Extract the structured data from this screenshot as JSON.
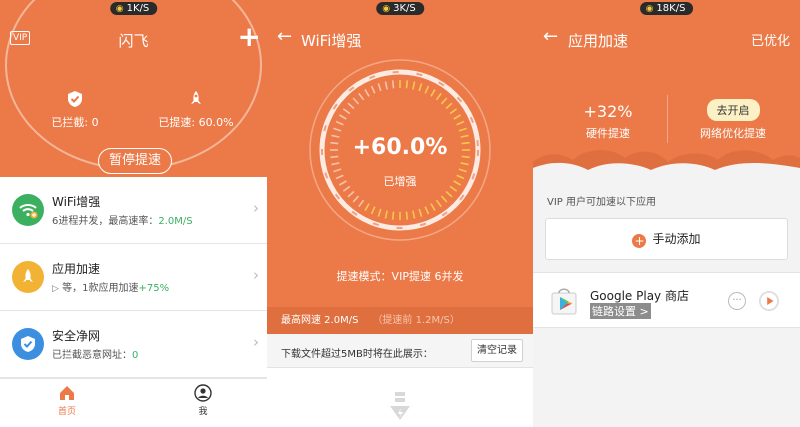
{
  "panel1": {
    "net_speed": "1K/S",
    "title": "闪飞",
    "vip_badge": "VIP",
    "blocked_label": "已拦截: 0",
    "boost_label": "已提速: 60.0%",
    "pause_button": "暂停提速",
    "items": [
      {
        "title": "WiFi增强",
        "desc_prefix": "6进程并发，最高速率：",
        "desc_highlight": "2.0M/S",
        "color": "#3bb061",
        "icon": "wifi-plus-icon"
      },
      {
        "title": "应用加速",
        "desc_prefix": "等，1款应用加速",
        "desc_highlight": "+75%",
        "color": "#f2b233",
        "icon": "rocket-icon"
      },
      {
        "title": "安全净网",
        "desc_prefix": "已拦截恶意网址：",
        "desc_highlight": "0",
        "color": "#3c8fe0",
        "icon": "shield-check-icon"
      }
    ],
    "tabs": [
      {
        "label": "首页",
        "active": true
      },
      {
        "label": "我",
        "active": false
      }
    ]
  },
  "panel2": {
    "net_speed": "3K/S",
    "title": "WiFi增强",
    "gauge_value": "+60.0%",
    "gauge_sub": "已增强",
    "mode_text": "提速模式：VIP提速 6并发",
    "max_speed": "最高网速 2.0M/S",
    "before_speed": "（提速前 1.2M/S）",
    "download_note": "下载文件超过5MB时将在此展示：",
    "clear_button": "清空记录"
  },
  "panel3": {
    "net_speed": "18K/S",
    "title": "应用加速",
    "status": "已优化",
    "hw_value": "+32%",
    "hw_label": "硬件提速",
    "net_button": "去开启",
    "net_label": "网络优化提速",
    "vip_note": "VIP 用户可加速以下应用",
    "manual_add": "手动添加",
    "app_name": "Google Play 商店",
    "app_link": "链路设置 >"
  },
  "colors": {
    "accent": "#ec7a48",
    "green": "#3bb061"
  }
}
